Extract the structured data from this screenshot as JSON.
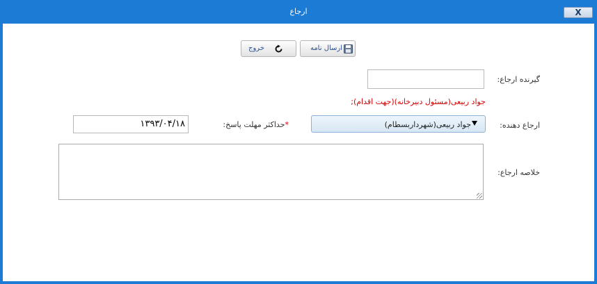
{
  "window": {
    "title": "ارجاع",
    "close_label": "X"
  },
  "toolbar": {
    "send_label": "ارسال نامه",
    "exit_label": "خروج",
    "send_icon": "floppy-disk-icon",
    "exit_icon": "circular-arrow-icon"
  },
  "form": {
    "recipient_label": "گیرنده ارجاع:",
    "recipient_value": "",
    "recipient_summary": "جواد ربیعی(مسئول دبیرخانه)(جهت اقدام);",
    "referrer_label": "ارجاع دهنده:",
    "referrer_selected": "جواد ربیعی(شهرداربسطام)",
    "deadline_label": "حداکثر مهلت پاسخ:",
    "deadline_required_mark": "*",
    "deadline_value": "۱۳۹۳/۰۴/۱۸",
    "summary_label": "خلاصه ارجاع:",
    "summary_value": ""
  },
  "colors": {
    "titlebar": "#1c7bd4",
    "required": "#d40000",
    "select_bg": "#d7e7f4"
  }
}
